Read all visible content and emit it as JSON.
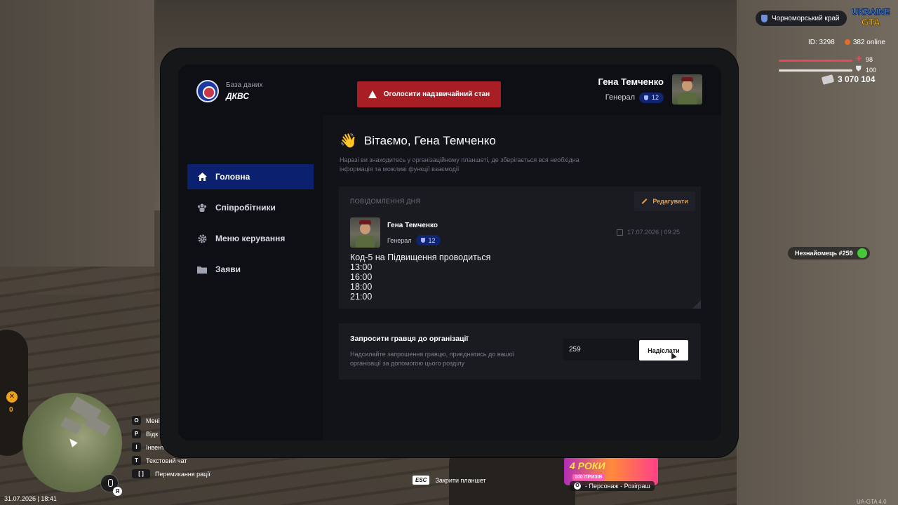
{
  "hud": {
    "region": "Чорноморський край",
    "logo": "UKRAINE GTA",
    "id_text": "ID: 3298",
    "online": "382 online",
    "health": "98",
    "armor": "100",
    "money": "3 070 104",
    "stranger": "Незнайомець #259",
    "wrench_count": "0",
    "datetime": "31.07.2026 | 18:41",
    "mic_key": "Я",
    "keys": [
      {
        "key": "O",
        "label": "Мені"
      },
      {
        "key": "P",
        "label": "Відк"
      },
      {
        "key": "I",
        "label": "Інвент"
      },
      {
        "key": "T",
        "label": "Текстовий чат"
      },
      {
        "key": "[ ]",
        "label": "Перемикання рації"
      }
    ],
    "esc_key": "ESC",
    "esc_label": "Закрити планшет",
    "promo_title": "4 РОКИ",
    "promo_sub": "100 ПРИЗІВ",
    "promo_key": "O",
    "promo_label": "- Персонаж - Розіграш",
    "version": "UA-GTA 4.0"
  },
  "tablet": {
    "org_label": "База даних",
    "org_name": "ДКВС",
    "emergency_button": "Оголосити надзвичайний стан",
    "user": {
      "name": "Гена Темченко",
      "rank": "Генерал",
      "level": "12"
    },
    "nav": [
      {
        "label": "Головна",
        "icon": "home-icon",
        "active": true
      },
      {
        "label": "Співробітники",
        "icon": "users-icon",
        "active": false
      },
      {
        "label": "Меню керування",
        "icon": "gear-icon",
        "active": false
      },
      {
        "label": "Заяви",
        "icon": "folder-icon",
        "active": false
      }
    ],
    "welcome": "Вітаємо, Гена Темченко",
    "welcome_emoji": "👋",
    "description": "Наразі ви знаходитесь у організаційному планшеті, де зберігається вся необхідна інформація та можливі функції взаємодії",
    "motd": {
      "header": "Повідомлення дня",
      "edit_label": "Редагувати",
      "author": "Гена Темченко",
      "rank": "Генерал",
      "level": "12",
      "date": "17.07.2026 | 09:25",
      "body": "Код-5 на Підвищення проводиться\n13:00\n16:00\n18:00\n21:00"
    },
    "invite": {
      "title": "Запросити гравця до організації",
      "description": "Надсилайте запрошення гравцю, приєднатись до вашої організації за допомогою цього розділу",
      "input_value": "259",
      "button": "Надіслати"
    }
  },
  "colors": {
    "active_nav": "#0c2070",
    "emergency": "#a81e24",
    "accent_orange": "#f0a13a",
    "health": "#e24a5c"
  }
}
